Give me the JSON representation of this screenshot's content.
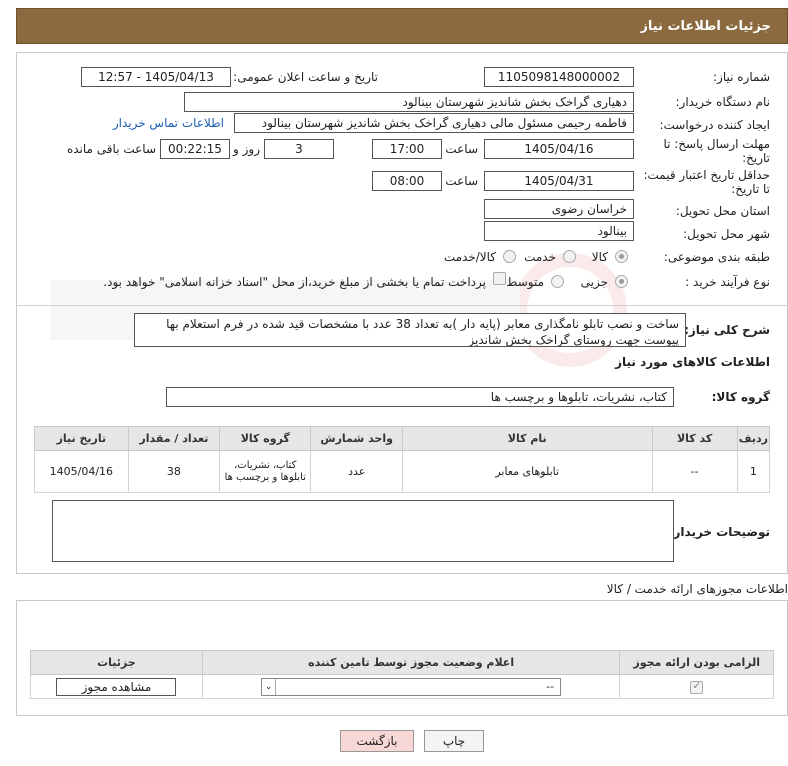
{
  "header": {
    "title": "جزئیات اطلاعات نیاز"
  },
  "form": {
    "need_number_label": "شماره نیاز:",
    "need_number": "1105098148000002",
    "announce_label": "تاریخ و ساعت اعلان عمومی:",
    "announce_value": "1405/04/13 - 12:57",
    "buyer_org_label": "نام دستگاه خریدار:",
    "buyer_org": "دهیاری گراخک بخش شاندیز شهرستان بینالود",
    "creator_label": "ایجاد کننده درخواست:",
    "creator": "فاطمه رحیمی مسئول مالی دهیاری گراخک بخش شاندیز شهرستان بینالود",
    "contact_link": "اطلاعات تماس خریدار",
    "deadline_label": "مهلت ارسال پاسخ: تا تاریخ:",
    "deadline_date": "1405/04/16",
    "hour_label": "ساعت",
    "deadline_time": "17:00",
    "days_value": "3",
    "days_label": "روز و",
    "remaining_time": "00:22:15",
    "remaining_label": "ساعت باقی مانده",
    "price_validity_label": "حداقل تاریخ اعتبار قیمت: تا تاریخ:",
    "price_validity_date": "1405/04/31",
    "price_validity_time": "08:00",
    "province_label": "استان محل تحویل:",
    "province": "خراسان رضوی",
    "city_label": "شهر محل تحویل:",
    "city": "بینالود",
    "category_label": "طبقه بندی موضوعی:",
    "category_options": [
      "کالا",
      "خدمت",
      "کالا/خدمت"
    ],
    "category_selected": "کالا",
    "process_label": "نوع فرآیند خرید :",
    "process_options": [
      "جزیی",
      "متوسط"
    ],
    "process_selected": "جزیی",
    "payment_text": "پرداخت تمام یا بخشی از مبلغ خرید،از محل \"اسناد خزانه اسلامی\" خواهد بود."
  },
  "description": {
    "label": "شرح کلی نیاز:",
    "text": "ساخت و نصب تابلو نامگذاری معابر (پایه دار )به تعداد 38 عدد با مشخصات قید شده در فرم استعلام بها پیوست جهت روستای گراخک بخش شاندیز"
  },
  "goods": {
    "section_title": "اطلاعات کالاهای مورد نیاز",
    "group_label": "گروه کالا:",
    "group_value": "کتاب، نشریات، تابلوها و برچسب ها",
    "columns": [
      "ردیف",
      "کد کالا",
      "نام کالا",
      "واحد شمارش",
      "گروه کالا",
      "تعداد / مقدار",
      "تاریخ نیاز"
    ],
    "rows": [
      {
        "row": "1",
        "code": "--",
        "name": "تابلوهای معابر",
        "unit": "عدد",
        "group": "کتاب، نشریات، تابلوها و برچسب ها",
        "qty": "38",
        "date": "1405/04/16"
      }
    ],
    "buyer_notes_label": "توضیحات خریدار:",
    "buyer_notes": ""
  },
  "permits": {
    "title": "اطلاعات مجوزهای ارائه خدمت / کالا",
    "columns": [
      "الزامی بودن ارائه مجوز",
      "اعلام وضعیت مجوز توسط تامین کننده",
      "جزئیات"
    ],
    "select_value": "--",
    "view_button": "مشاهده مجوز"
  },
  "footer": {
    "print_button": "چاپ",
    "back_button": "بازگشت"
  },
  "colors": {
    "header_bg": "#8a6a3e",
    "link": "#1a5fb4",
    "back_button_bg": "#f8d7d7"
  }
}
